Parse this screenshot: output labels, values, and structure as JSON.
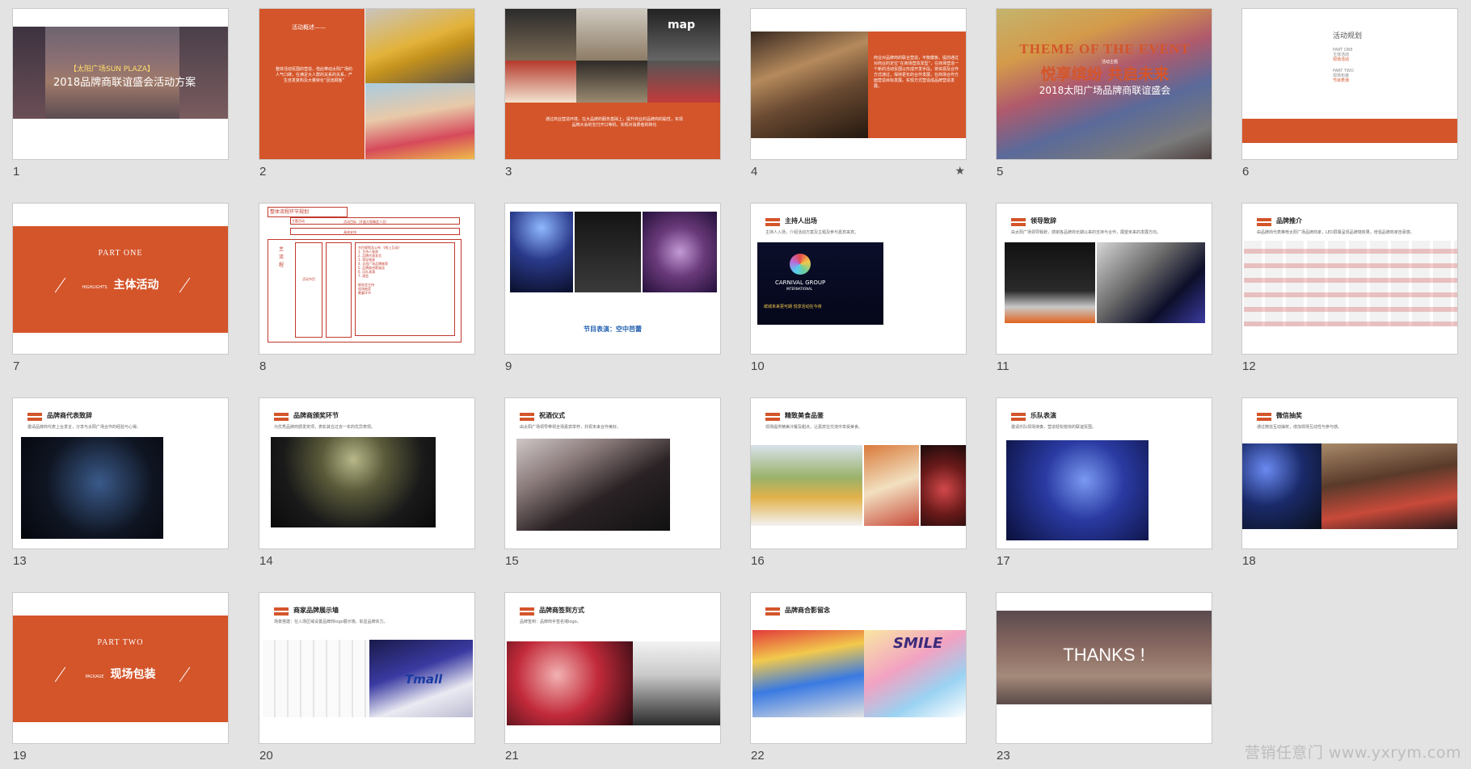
{
  "slides": [
    {
      "num": "1",
      "title": "2018品牌商联谊盛会活动方案",
      "subtitle": "【太阳广场SUN PLAZA】"
    },
    {
      "num": "2",
      "heading": "活动概述——",
      "body": "整体活动氛围的营造，借此带动太阳广场的人气口碑，在满足大人群的关系的关系，产生自发复购及大量转化“回流顾客”"
    },
    {
      "num": "3",
      "body": "通过商业营造环境，在大品牌的服务基础上，提升商业的品牌商的黏性，实现品牌大会的支付开口等机，实现对消费者的转化"
    },
    {
      "num": "4",
      "body": "商业对品牌商的联合营造，平衡模板，提前通过对商业的定位“在商场营造发型”，在商场营造一个新的活动氛围以形成开发手段。将资源及合作方式通过，保持更长的合作发展，在商场合作方面营造目标发展。实现方式营造成品牌营造发展。"
    },
    {
      "num": "5",
      "title_en": "THEME OF THE EVENT",
      "title_cn": "悦享缤纷 共启未来",
      "subtitle": "2018太阳广场品牌商联谊盛会",
      "tag": "活动主题"
    },
    {
      "num": "6",
      "heading": "活动规划",
      "part_one": "PART ONE",
      "part_one_item": "主体活动",
      "part_one_sub": "现场活动",
      "part_two": "PART TWO",
      "part_two_item": "现场包装",
      "part_two_sub": "节目表演"
    },
    {
      "num": "7",
      "part": "PART ONE",
      "tag": "HIGHLIGHTS",
      "title": "主体活动"
    },
    {
      "num": "8",
      "heading": "整体流程环节规划",
      "row1_label": "主题活动",
      "row2_label": "主 流 程",
      "box1": "活动目标（开展方案确定人员）",
      "box2": "具体安排",
      "list_title": "节目规划及公布  《线上互动》",
      "list": [
        "1. 主持人致辞",
        "2. 品牌代表发言",
        "3. 领导致辞",
        "4. 太阳广场品牌推荐",
        "5. 品牌商合影留念",
        "6. 乐队表演",
        "7. 酒会"
      ],
      "extra": [
        "联欢会主持",
        "现场抽奖",
        "晚宴环节"
      ],
      "left_box": "活动节目"
    },
    {
      "num": "9",
      "caption": "节目表演：空中芭蕾"
    },
    {
      "num": "10",
      "heading": "主持人出场",
      "sub": "主持人入场，介绍活动方案及主题及参与嘉宾来宾。",
      "banner": "CARNIVAL GROUP",
      "banner_sub": "INTERNATIONAL",
      "banner_line": "缤城未来更可期  悦享活动在今夜"
    },
    {
      "num": "11",
      "heading": "领导致辞",
      "sub": "由太阳广场领导致辞，感谢各品牌商长期以来的支持与合作，展望未来的发展方向。"
    },
    {
      "num": "12",
      "heading": "品牌推介",
      "sub": "由品牌商代表推荐太阳广场品牌商家，LED屏幕呈现品牌墙效果，增强品牌商家自豪感。"
    },
    {
      "num": "13",
      "heading": "品牌商代表致辞",
      "sub": "邀请品牌商代表上台发言，分享与太阳广场合作的经验与心得。"
    },
    {
      "num": "14",
      "heading": "品牌商颁奖环节",
      "sub": "为优秀品牌商颁发奖项，表彰其在过去一年的优异表现。"
    },
    {
      "num": "15",
      "heading": "祝酒仪式",
      "sub": "由太阳广场领导带领全场嘉宾举杯，共祝未来合作美好。"
    },
    {
      "num": "16",
      "heading": "精致美食品鉴",
      "sub": "现场提供精美冷餐及甜点，让嘉宾在交流中享受美食。"
    },
    {
      "num": "17",
      "heading": "乐队表演",
      "sub": "邀请乐队现场演奏，营造轻松愉快的联谊氛围。"
    },
    {
      "num": "18",
      "heading": "微信抽奖",
      "sub": "通过微信互动抽奖，增加现场互动性与参与感。"
    },
    {
      "num": "19",
      "part": "PART TWO",
      "tag": "PACKAGE",
      "title": "现场包装"
    },
    {
      "num": "20",
      "heading": "商家品牌展示墙",
      "sub": "场景搭建：在入场区域设置品牌商logo展示墙，彰显品牌实力。",
      "brand": "Tmall"
    },
    {
      "num": "21",
      "heading": "品牌商签到方式",
      "sub": "品牌签到：品牌商手签名墙logo。"
    },
    {
      "num": "22",
      "heading": "品牌商合影留念",
      "sub": "",
      "sign": "SMILE"
    },
    {
      "num": "23",
      "title": "THANKS !"
    }
  ],
  "watermark": "营销任意门 www.yxrym.com",
  "colors": {
    "accent": "#d4552a",
    "background": "#e3e3e3"
  }
}
